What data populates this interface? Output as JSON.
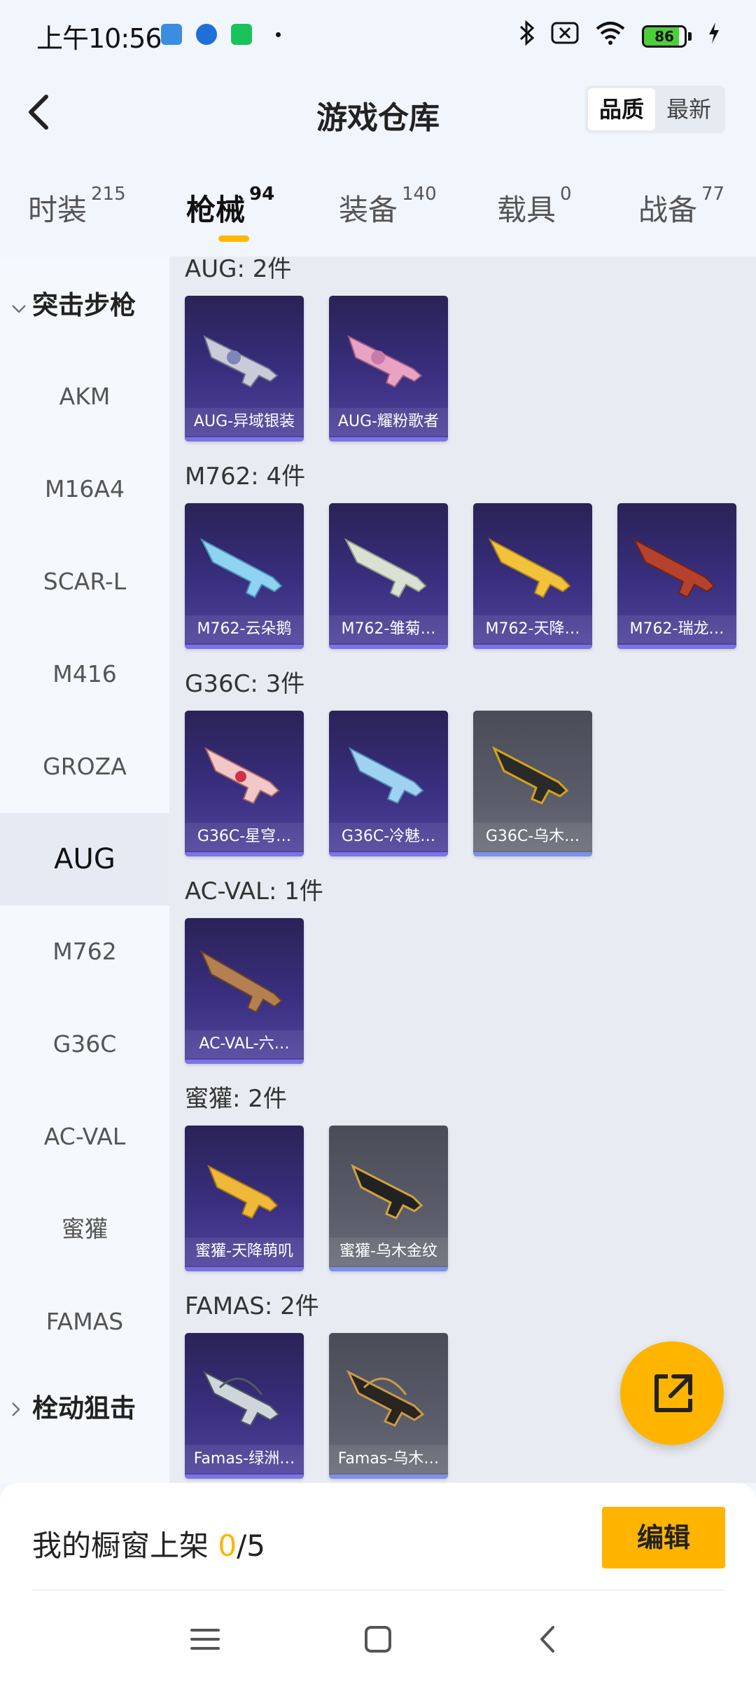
{
  "status_bar": {
    "time": "上午10:56",
    "battery_level": "86",
    "battery_fraction": 0.86,
    "notification_icons": [
      "card-app-icon",
      "alipay-icon",
      "wechat-icon"
    ]
  },
  "header": {
    "title": "游戏仓库",
    "sort_options": [
      "品质",
      "最新"
    ],
    "sort_selected": "品质"
  },
  "tabs": [
    {
      "label": "时装",
      "count": "215"
    },
    {
      "label": "枪械",
      "count": "94"
    },
    {
      "label": "装备",
      "count": "140"
    },
    {
      "label": "载具",
      "count": "0"
    },
    {
      "label": "战备",
      "count": "77"
    }
  ],
  "active_tab": "枪械",
  "sidebar": {
    "category_open": "突击步枪",
    "items": [
      "AKM",
      "M16A4",
      "SCAR-L",
      "M416",
      "GROZA",
      "AUG",
      "M762",
      "G36C",
      "AC-VAL",
      "蜜獾",
      "FAMAS"
    ],
    "active_item": "AUG",
    "category_closed": "栓动狙击"
  },
  "groups": [
    {
      "title": "AUG: 2件",
      "items": [
        {
          "label": "AUG-异域银装",
          "rarity": "purple"
        },
        {
          "label": "AUG-耀粉歌者",
          "rarity": "purple"
        }
      ]
    },
    {
      "title": "M762: 4件",
      "items": [
        {
          "label": "M762-云朵鹅",
          "rarity": "purple"
        },
        {
          "label": "M762-雏菊…",
          "rarity": "purple"
        },
        {
          "label": "M762-天降…",
          "rarity": "purple"
        },
        {
          "label": "M762-瑞龙…",
          "rarity": "purple"
        }
      ]
    },
    {
      "title": "G36C: 3件",
      "items": [
        {
          "label": "G36C-星穹…",
          "rarity": "purple"
        },
        {
          "label": "G36C-冷魅…",
          "rarity": "purple"
        },
        {
          "label": "G36C-乌木…",
          "rarity": "gray"
        }
      ]
    },
    {
      "title": "AC-VAL: 1件",
      "items": [
        {
          "label": "AC-VAL-六…",
          "rarity": "purple"
        }
      ]
    },
    {
      "title": "蜜獾: 2件",
      "items": [
        {
          "label": "蜜獾-天降萌叽",
          "rarity": "purple"
        },
        {
          "label": "蜜獾-乌木金纹",
          "rarity": "gray"
        }
      ]
    },
    {
      "title": "FAMAS: 2件",
      "items": [
        {
          "label": "Famas-绿洲…",
          "rarity": "purple"
        },
        {
          "label": "Famas-乌木…",
          "rarity": "gray"
        }
      ]
    }
  ],
  "bottom": {
    "shelf_label": "我的橱窗上架",
    "shelf_current": "0",
    "shelf_total": "/5",
    "edit_label": "编辑"
  },
  "colors": {
    "accent": "#ffb400",
    "card_purple": "#3a2f80",
    "card_gray": "#5a5d69"
  }
}
